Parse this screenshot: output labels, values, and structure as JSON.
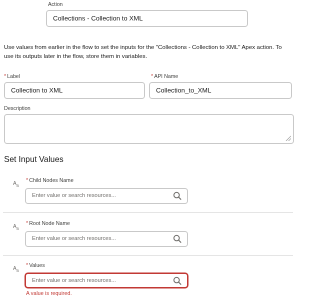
{
  "action": {
    "label": "Action",
    "value": "Collections - Collection to XML"
  },
  "description": "Use values from earlier in the flow to set the inputs for the \"Collections - Collection to XML\" Apex action. To use its outputs later in the flow, store them in variables.",
  "label_field": {
    "required_mark": "*",
    "label": "Label",
    "value": "Collection to XML"
  },
  "api_name_field": {
    "required_mark": "*",
    "label": "API Name",
    "value": "Collection_to_XML"
  },
  "description_field": {
    "label": "Description",
    "value": ""
  },
  "input_section": {
    "title": "Set Input Values",
    "resource_type_icon": "A",
    "resource_type_sub": "B",
    "inputs": [
      {
        "required_mark": "*",
        "label": "Child Nodes Name",
        "placeholder": "Enter value or search resources..."
      },
      {
        "required_mark": "*",
        "label": "Root Node Name",
        "placeholder": "Enter value or search resources..."
      },
      {
        "required_mark": "*",
        "label": "Values",
        "placeholder": "Enter value or search resources...",
        "error": "A value is required."
      }
    ]
  },
  "colors": {
    "error": "#c23934",
    "border": "#c9c9c9",
    "label": "#3e3e3c"
  }
}
